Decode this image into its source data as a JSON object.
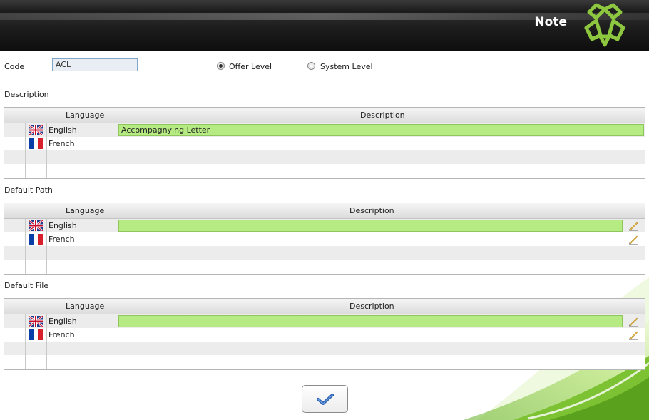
{
  "header": {
    "title": "Note"
  },
  "code": {
    "label": "Code",
    "value": "ACL"
  },
  "level": {
    "options": [
      {
        "label": "Offer Level",
        "selected": true
      },
      {
        "label": "System Level",
        "selected": false
      }
    ]
  },
  "columns": {
    "language": "Language",
    "description": "Description"
  },
  "description_section": {
    "label": "Description",
    "rows": [
      {
        "language": "English",
        "flag": "uk-flag-icon",
        "value": "Accompagnying Letter"
      },
      {
        "language": "French",
        "flag": "france-flag-icon",
        "value": ""
      }
    ]
  },
  "default_path_section": {
    "label": "Default Path",
    "rows": [
      {
        "language": "English",
        "flag": "uk-flag-icon",
        "value": ""
      },
      {
        "language": "French",
        "flag": "france-flag-icon",
        "value": ""
      }
    ]
  },
  "default_file_section": {
    "label": "Default File",
    "rows": [
      {
        "language": "English",
        "flag": "uk-flag-icon",
        "value": ""
      },
      {
        "language": "French",
        "flag": "france-flag-icon",
        "value": ""
      }
    ]
  },
  "confirm_button": {
    "icon": "checkmark-icon"
  }
}
